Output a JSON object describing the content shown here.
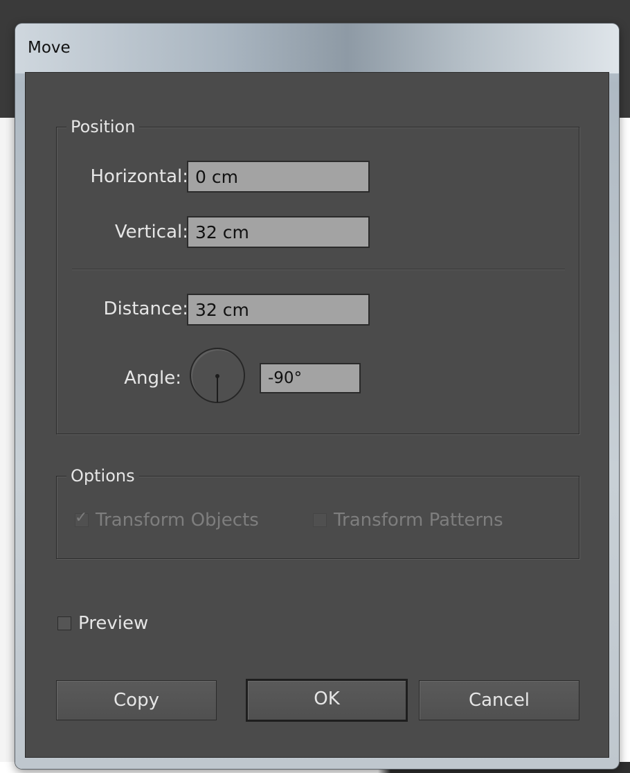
{
  "dialog": {
    "title": "Move"
  },
  "position": {
    "legend": "Position",
    "horizontal_label": "Horizontal:",
    "horizontal_value": "0 cm",
    "vertical_label": "Vertical:",
    "vertical_value": "32 cm",
    "distance_label": "Distance:",
    "distance_value": "32 cm",
    "angle_label": "Angle:",
    "angle_value": "-90°",
    "angle_dial_degrees": -90
  },
  "options": {
    "legend": "Options",
    "transform_objects_label": "Transform Objects",
    "transform_objects_checked": true,
    "transform_patterns_label": "Transform Patterns",
    "transform_patterns_checked": false
  },
  "preview": {
    "label": "Preview",
    "checked": false
  },
  "buttons": {
    "copy": "Copy",
    "ok": "OK",
    "cancel": "Cancel"
  },
  "icons": {
    "angle_dial": "angle-dial-icon",
    "check": "check-mark-icon"
  },
  "colors": {
    "panel_bg": "#4b4b4b",
    "field_bg": "#a3a3a3",
    "text": "#e6e6e6"
  }
}
